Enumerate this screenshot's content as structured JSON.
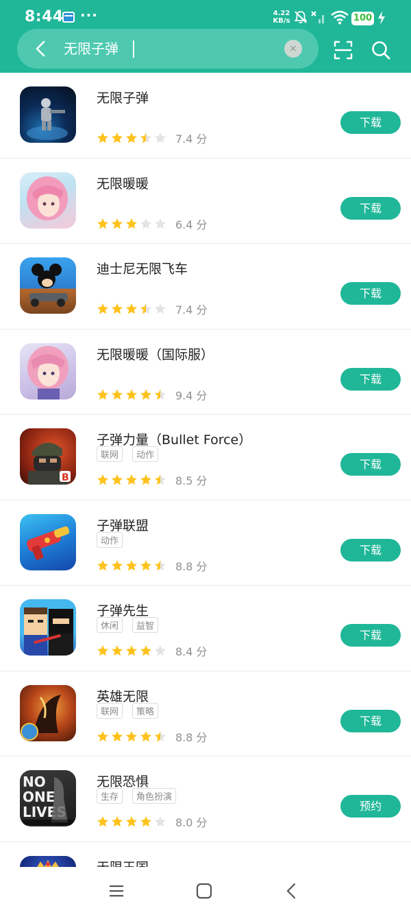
{
  "status": {
    "time": "8:44",
    "more": "···",
    "speed_value": "4.22",
    "speed_unit": "KB/s",
    "battery": "100"
  },
  "search": {
    "query": "无限子弹",
    "clear_symbol": "×"
  },
  "icons": {
    "back": "back-arrow-icon",
    "clear": "clear-icon",
    "scan": "scan-icon",
    "search": "search-icon"
  },
  "colors": {
    "accent": "#1fb798",
    "star": "#ffc21c",
    "star_empty": "#e3e3e3"
  },
  "apps": [
    {
      "name": "无限子弹",
      "tags": [],
      "rating": 3.5,
      "score": "7.4 分",
      "button": "下载"
    },
    {
      "name": "无限暖暖",
      "tags": [],
      "rating": 3,
      "score": "6.4 分",
      "button": "下载"
    },
    {
      "name": "迪士尼无限飞车",
      "tags": [],
      "rating": 3.5,
      "score": "7.4 分",
      "button": "下载"
    },
    {
      "name": "无限暖暖（国际服）",
      "tags": [],
      "rating": 4.5,
      "score": "9.4 分",
      "button": "下载"
    },
    {
      "name": "子弹力量（Bullet Force）",
      "tags": [
        "联网",
        "动作"
      ],
      "rating": 4.5,
      "score": "8.5 分",
      "button": "下载"
    },
    {
      "name": "子弹联盟",
      "tags": [
        "动作"
      ],
      "rating": 4.5,
      "score": "8.8 分",
      "button": "下载"
    },
    {
      "name": "子弹先生",
      "tags": [
        "休闲",
        "益智"
      ],
      "rating": 4,
      "score": "8.4 分",
      "button": "下载"
    },
    {
      "name": "英雄无限",
      "tags": [
        "联网",
        "策略"
      ],
      "rating": 4.5,
      "score": "8.8 分",
      "button": "下载"
    },
    {
      "name": "无限恐惧",
      "tags": [
        "生存",
        "角色扮演"
      ],
      "rating": 4,
      "score": "8.0 分",
      "button": "预约"
    },
    {
      "name": "无限王国",
      "tags": [],
      "rating": 0,
      "score": "",
      "button": ""
    }
  ],
  "nav": {
    "menu": "menu-icon",
    "home": "home-icon",
    "back": "back-icon"
  }
}
